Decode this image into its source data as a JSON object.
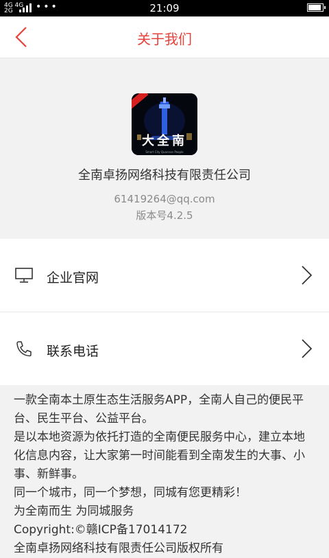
{
  "status_bar": {
    "network_top": "4G 4G",
    "network_bottom": "2G",
    "time": "21:09",
    "battery_level": 0.9
  },
  "nav": {
    "title": "关于我们"
  },
  "app": {
    "icon_text": "大全南",
    "icon_subtext": "Smart City Quannan People",
    "company_name": "全南卓扬网络科技有限责任公司",
    "email": "61419264@qq.com",
    "version": "版本号4.2.5"
  },
  "menu": {
    "items": [
      {
        "label": "企业官网",
        "icon": "monitor-icon"
      },
      {
        "label": "联系电话",
        "icon": "phone-icon"
      }
    ]
  },
  "description": {
    "lines": [
      "一款全南本土原生态生活服务APP，全南人自己的便民平台、民生平台、公益平台。",
      "是以本地资源为依托打造的全南便民服务中心，建立本地化信息内容，让大家第一时间能看到全南发生的大事、小事、新鲜事。",
      "同一个城市，同一个梦想，同城有您更精彩！",
      "为全南而生 为同城服务",
      "Copyright:©赣ICP备17014172",
      "全南卓扬网络科技有限责任公司版权所有"
    ]
  },
  "colors": {
    "accent": "#e8413a",
    "background": "#f2f2f2"
  }
}
